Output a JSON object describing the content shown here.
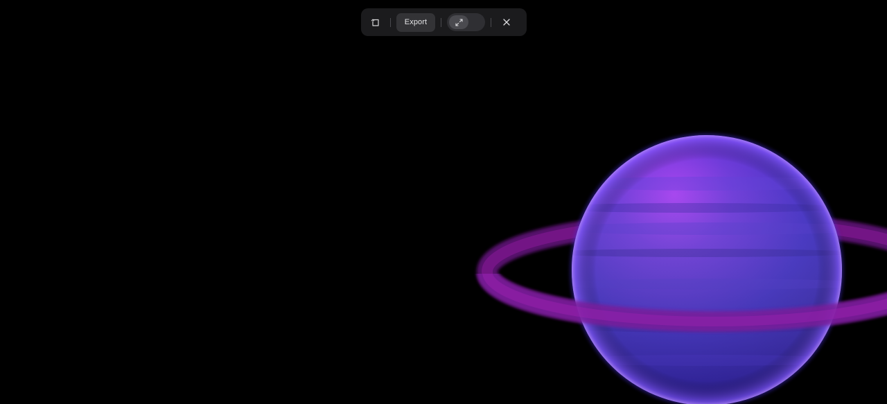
{
  "toolbar": {
    "export_label": "Export",
    "icons": {
      "reset": "reset-rotate-icon",
      "expand": "expand-arrows-icon",
      "close": "close-icon"
    },
    "colors": {
      "background": "#1b1b1d",
      "export_button": "#333336",
      "toggle_track": "#2f2f33"
    }
  },
  "scene": {
    "background": "#000000",
    "planet_colors": {
      "highlight": "#a43df0",
      "body": "#3b2ac0",
      "shadow": "#1d1468",
      "ring": "#8a1a9a"
    }
  }
}
